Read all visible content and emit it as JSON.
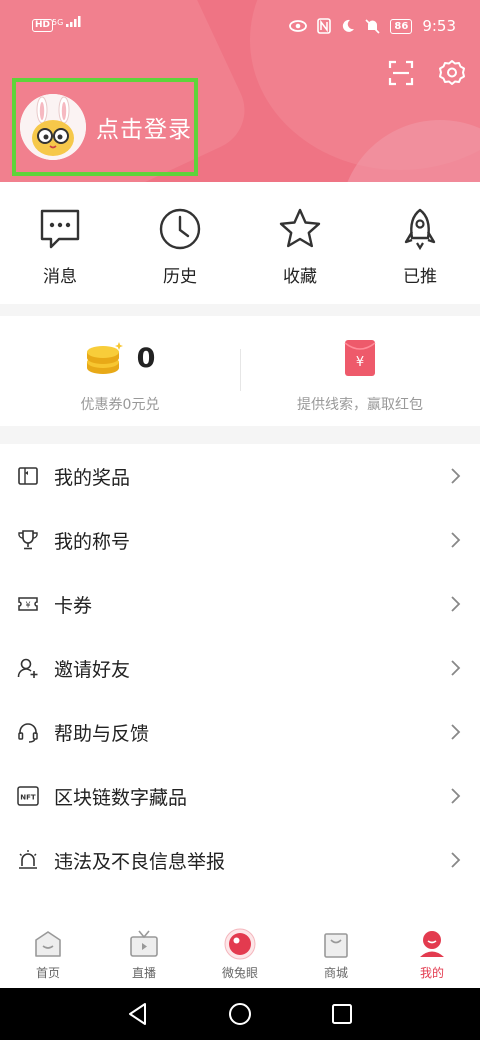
{
  "status": {
    "network": "HD",
    "signal_label": "5G",
    "battery": "86",
    "time": "9:53"
  },
  "profile": {
    "login_label": "点击登录"
  },
  "quick_nav": [
    {
      "label": "消息",
      "icon": "message-icon"
    },
    {
      "label": "历史",
      "icon": "clock-icon"
    },
    {
      "label": "收藏",
      "icon": "star-icon"
    },
    {
      "label": "已推",
      "icon": "rocket-icon"
    }
  ],
  "coupons": {
    "count": "0",
    "coupon_label": "优惠券0元兑",
    "redpacket_label": "提供线索，赢取红包",
    "redpacket_symbol": "¥"
  },
  "menu": [
    {
      "label": "我的奖品",
      "icon": "gift-icon"
    },
    {
      "label": "我的称号",
      "icon": "trophy-icon"
    },
    {
      "label": "卡券",
      "icon": "ticket-icon"
    },
    {
      "label": "邀请好友",
      "icon": "add-user-icon"
    },
    {
      "label": "帮助与反馈",
      "icon": "headset-icon"
    },
    {
      "label": "区块链数字藏品",
      "icon": "nft-icon",
      "badge": "NFT"
    },
    {
      "label": "违法及不良信息举报",
      "icon": "alarm-icon"
    }
  ],
  "tabs": [
    {
      "label": "首页",
      "icon": "home-icon",
      "active": false
    },
    {
      "label": "直播",
      "icon": "tv-icon",
      "active": false
    },
    {
      "label": "微兔眼",
      "icon": "eye-icon",
      "active": false
    },
    {
      "label": "商城",
      "icon": "shopping-bag-icon",
      "active": false
    },
    {
      "label": "我的",
      "icon": "profile-icon",
      "active": true
    }
  ],
  "colors": {
    "header": "#ef7484",
    "accent": "#e33b4f",
    "highlight": "#5fd33a"
  }
}
